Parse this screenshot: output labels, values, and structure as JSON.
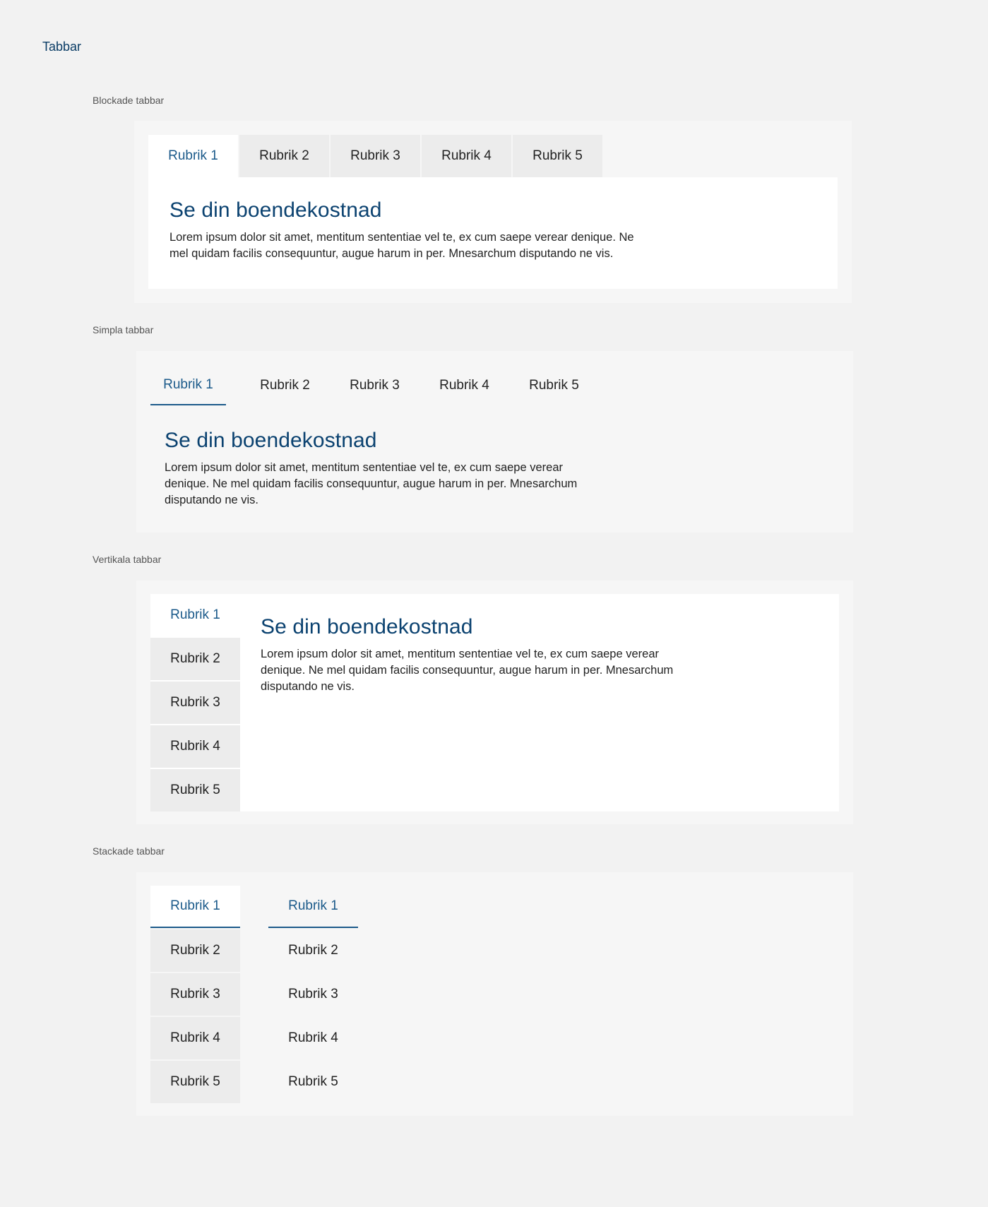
{
  "page": {
    "title": "Tabbar"
  },
  "colors": {
    "accent": "#1b5a8a",
    "heading": "#0b4270",
    "background": "#f2f2f2",
    "inactive_tab": "#ececec"
  },
  "blocked": {
    "label": "Blockade tabbar",
    "tabs": [
      "Rubrik 1",
      "Rubrik 2",
      "Rubrik 3",
      "Rubrik 4",
      "Rubrik 5"
    ],
    "active": 0,
    "heading": "Se din boendekostnad",
    "text": "Lorem ipsum dolor sit amet, mentitum sententiae vel te, ex cum saepe verear denique. Ne mel quidam facilis consequuntur, augue harum in per. Mnesarchum disputando ne vis."
  },
  "simple": {
    "label": "Simpla tabbar",
    "tabs": [
      "Rubrik 1",
      "Rubrik 2",
      "Rubrik 3",
      "Rubrik 4",
      "Rubrik 5"
    ],
    "active": 0,
    "heading": "Se din boendekostnad",
    "text": "Lorem ipsum dolor sit amet, mentitum sententiae vel te, ex cum saepe verear denique. Ne mel quidam facilis consequuntur, augue harum in per. Mnesarchum disputando ne vis."
  },
  "vertical": {
    "label": "Vertikala tabbar",
    "tabs": [
      "Rubrik 1",
      "Rubrik 2",
      "Rubrik 3",
      "Rubrik 4",
      "Rubrik 5"
    ],
    "active": 0,
    "heading": "Se din boendekostnad",
    "text": "Lorem ipsum dolor sit amet, mentitum sententiae vel te, ex cum saepe verear denique. Ne mel quidam facilis consequuntur, augue harum in per. Mnesarchum disputando ne vis."
  },
  "stacked": {
    "label": "Stackade tabbar",
    "left_tabs": [
      "Rubrik 1",
      "Rubrik 2",
      "Rubrik 3",
      "Rubrik 4",
      "Rubrik 5"
    ],
    "right_tabs": [
      "Rubrik 1",
      "Rubrik 2",
      "Rubrik 3",
      "Rubrik 4",
      "Rubrik 5"
    ],
    "active": 0
  }
}
